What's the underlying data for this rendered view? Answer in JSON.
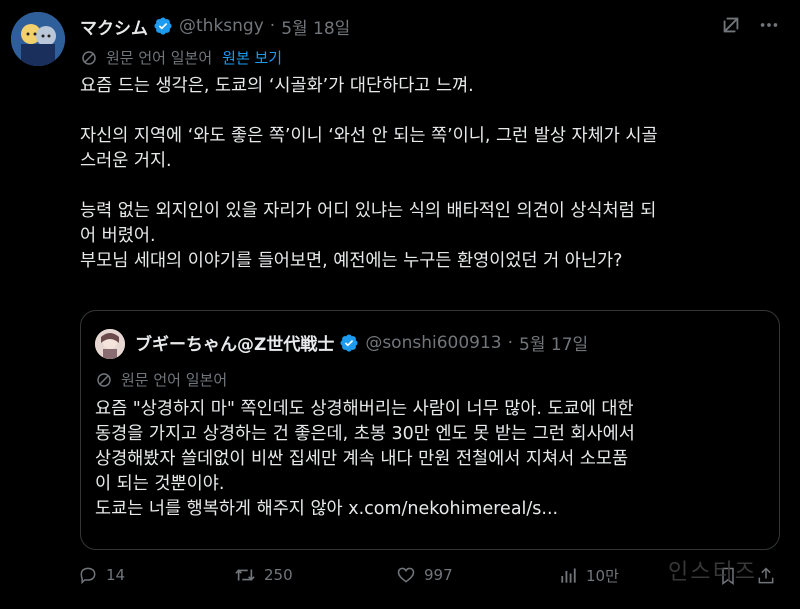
{
  "author": {
    "name": "マクシム",
    "handle": "@thksngy",
    "date": "5월 18일"
  },
  "translation": {
    "label": "원문 언어 일본어",
    "link": "원본 보기"
  },
  "body": [
    "요즘 드는 생각은, 도쿄의 ‘시골화’가 대단하다고 느껴.",
    "자신의 지역에 ‘와도 좋은 쪽’이니 ‘와선 안 되는 쪽’이니, 그런 발상 자체가 시골",
    "스러운 거지.",
    "능력 없는 외지인이 있을 자리가 어디 있냐는 식의 배타적인 의견이 상식처럼 되",
    "어 버렸어.",
    "부모님 세대의 이야기를 들어보면, 예전에는 누구든 환영이었던 거 아닌가?"
  ],
  "quote": {
    "name": "ブギーちゃん@Z世代戦士",
    "handle": "@sonshi600913",
    "date": "5월 17일",
    "translation_label": "원문 언어 일본어",
    "lines": [
      "요즘 \"상경하지 마\" 쪽인데도 상경해버리는 사람이 너무 많아. 도쿄에 대한",
      "동경을 가지고 상경하는 건 좋은데, 초봉 30만 엔도 못 받는 그런 회사에서",
      "상경해봤자 쓸데없이 비싼 집세만 계속 내다 만원 전철에서 지쳐서 소모품",
      "이 되는 것뿐이야.",
      "도쿄는 너를 행복하게 해주지 않아 x.com/nekohimereal/s..."
    ]
  },
  "actions": {
    "replies": "14",
    "reposts": "250",
    "likes": "997",
    "views": "10만"
  },
  "watermark": "인스티즈",
  "colors": {
    "background": "#000000",
    "text": "#e7e9ea",
    "muted": "#71767b",
    "accent": "#1d9bf0",
    "border": "#333639"
  },
  "icons": [
    "verified-badge-icon",
    "grok-icon",
    "more-icon",
    "translate-icon",
    "reply-icon",
    "repost-icon",
    "like-icon",
    "views-icon",
    "bookmark-icon",
    "share-icon"
  ]
}
